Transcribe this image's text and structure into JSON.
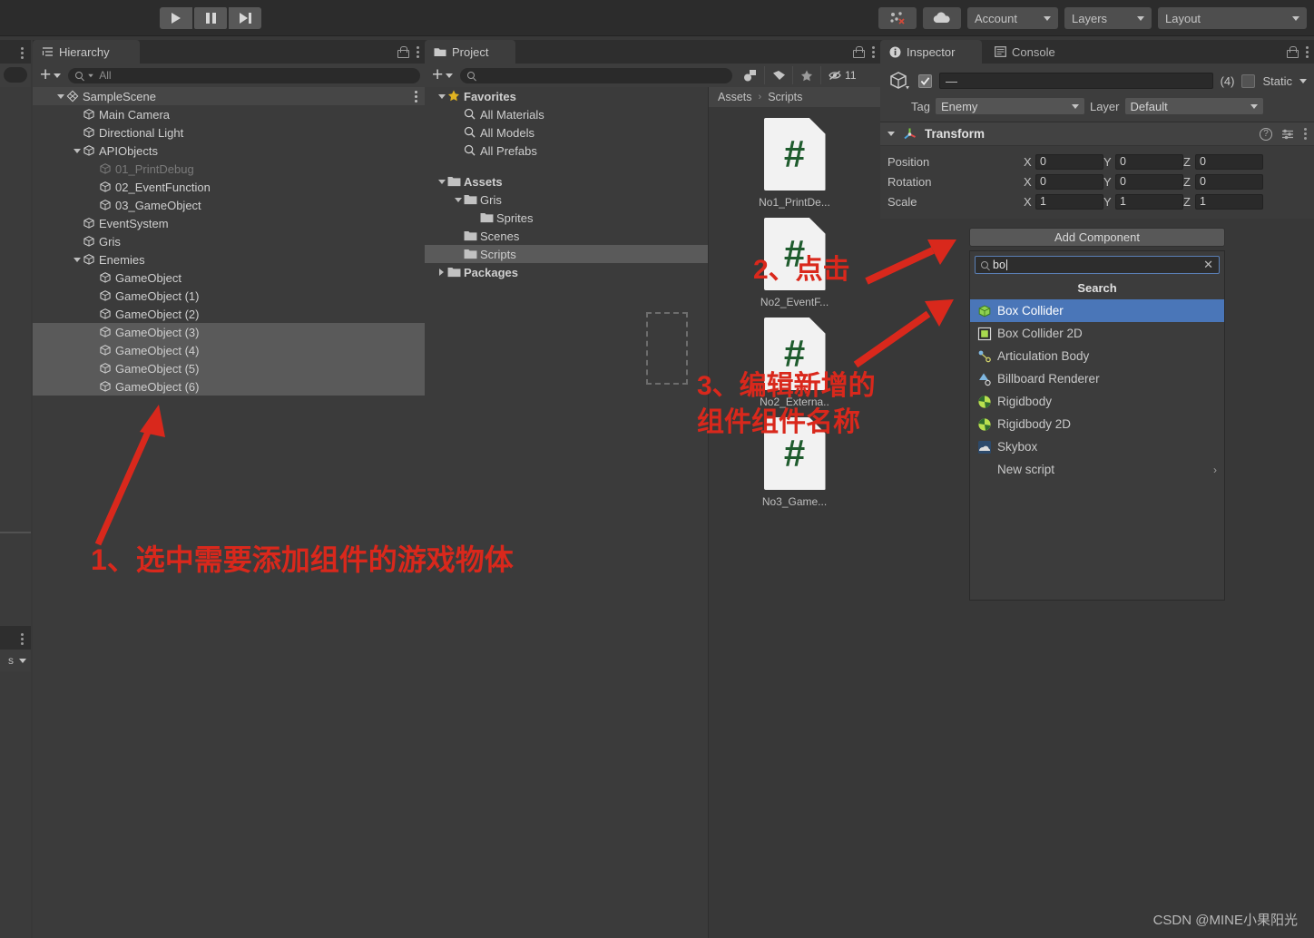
{
  "toolbar": {
    "play_label": "play-icon",
    "pause_label": "pause-icon",
    "step_label": "step-icon",
    "cloud_label": "cloud-icon",
    "collab_label": "collab-icon",
    "account": "Account",
    "layers": "Layers",
    "layout": "Layout"
  },
  "hierarchy": {
    "tab": "Hierarchy",
    "search_placeholder": "All",
    "items": [
      {
        "label": "SampleScene",
        "indent": 0,
        "arrow": "down",
        "icon": "scene-icon",
        "state": "scene"
      },
      {
        "label": "Main Camera",
        "indent": 1,
        "arrow": "none",
        "icon": "cube-icon",
        "state": "normal"
      },
      {
        "label": "Directional Light",
        "indent": 1,
        "arrow": "none",
        "icon": "cube-icon",
        "state": "normal"
      },
      {
        "label": "APIObjects",
        "indent": 1,
        "arrow": "down",
        "icon": "cube-icon",
        "state": "normal"
      },
      {
        "label": "01_PrintDebug",
        "indent": 2,
        "arrow": "none",
        "icon": "cube-icon",
        "state": "disabled"
      },
      {
        "label": "02_EventFunction",
        "indent": 2,
        "arrow": "none",
        "icon": "cube-icon",
        "state": "normal"
      },
      {
        "label": "03_GameObject",
        "indent": 2,
        "arrow": "none",
        "icon": "cube-icon",
        "state": "normal"
      },
      {
        "label": "EventSystem",
        "indent": 1,
        "arrow": "none",
        "icon": "cube-icon",
        "state": "normal"
      },
      {
        "label": "Gris",
        "indent": 1,
        "arrow": "none",
        "icon": "cube-icon",
        "state": "normal"
      },
      {
        "label": "Enemies",
        "indent": 1,
        "arrow": "down",
        "icon": "cube-icon",
        "state": "normal"
      },
      {
        "label": "GameObject",
        "indent": 2,
        "arrow": "none",
        "icon": "cube-icon",
        "state": "normal"
      },
      {
        "label": "GameObject (1)",
        "indent": 2,
        "arrow": "none",
        "icon": "cube-icon",
        "state": "normal"
      },
      {
        "label": "GameObject (2)",
        "indent": 2,
        "arrow": "none",
        "icon": "cube-icon",
        "state": "normal"
      },
      {
        "label": "GameObject (3)",
        "indent": 2,
        "arrow": "none",
        "icon": "cube-icon",
        "state": "selected"
      },
      {
        "label": "GameObject (4)",
        "indent": 2,
        "arrow": "none",
        "icon": "cube-icon",
        "state": "selected"
      },
      {
        "label": "GameObject (5)",
        "indent": 2,
        "arrow": "none",
        "icon": "cube-icon",
        "state": "selected"
      },
      {
        "label": "GameObject (6)",
        "indent": 2,
        "arrow": "none",
        "icon": "cube-icon",
        "state": "selected"
      }
    ]
  },
  "project": {
    "tab": "Project",
    "search_placeholder": "",
    "hidden_count": "11",
    "tree": [
      {
        "label": "Favorites",
        "indent": 0,
        "arrow": "down",
        "icon": "star-icon",
        "bold": true
      },
      {
        "label": "All Materials",
        "indent": 1,
        "arrow": "none",
        "icon": "search-icon",
        "bold": false
      },
      {
        "label": "All Models",
        "indent": 1,
        "arrow": "none",
        "icon": "search-icon",
        "bold": false
      },
      {
        "label": "All Prefabs",
        "indent": 1,
        "arrow": "none",
        "icon": "search-icon",
        "bold": false
      },
      {
        "label": "",
        "indent": 0,
        "arrow": "none",
        "icon": "spacer",
        "bold": false
      },
      {
        "label": "Assets",
        "indent": 0,
        "arrow": "down",
        "icon": "folder-icon",
        "bold": true
      },
      {
        "label": "Gris",
        "indent": 1,
        "arrow": "down",
        "icon": "folder-icon",
        "bold": false
      },
      {
        "label": "Sprites",
        "indent": 2,
        "arrow": "none",
        "icon": "folder-icon",
        "bold": false
      },
      {
        "label": "Scenes",
        "indent": 1,
        "arrow": "none",
        "icon": "folder-icon",
        "bold": false
      },
      {
        "label": "Scripts",
        "indent": 1,
        "arrow": "none",
        "icon": "folder-icon",
        "bold": false,
        "selected": true
      },
      {
        "label": "Packages",
        "indent": 0,
        "arrow": "right",
        "icon": "folder-icon",
        "bold": true
      }
    ],
    "breadcrumb": [
      "Assets",
      "Scripts"
    ],
    "assets": [
      {
        "label": "No1_PrintDe...",
        "icon": "csharp-script-icon"
      },
      {
        "label": "No2_EventF...",
        "icon": "csharp-script-icon"
      },
      {
        "label": "No2_Externa..",
        "icon": "csharp-script-icon"
      },
      {
        "label": "No3_Game...",
        "icon": "csharp-script-icon"
      }
    ]
  },
  "inspector": {
    "tab": "Inspector",
    "console_tab": "Console",
    "name_value": "—",
    "selection_count": "(4)",
    "static_label": "Static",
    "tag_label": "Tag",
    "tag_value": "Enemy",
    "layer_label": "Layer",
    "layer_value": "Default",
    "transform": {
      "title": "Transform",
      "rows": [
        {
          "label": "Position",
          "x": "0",
          "y": "0",
          "z": "0"
        },
        {
          "label": "Rotation",
          "x": "0",
          "y": "0",
          "z": "0"
        },
        {
          "label": "Scale",
          "x": "1",
          "y": "1",
          "z": "1"
        }
      ]
    },
    "add_component": {
      "button_label": "Add Component",
      "search_value": "bo",
      "clear_label": "✕",
      "title": "Search",
      "items": [
        {
          "label": "Box Collider",
          "icon": "box-collider-icon",
          "selected": true,
          "submenu": false
        },
        {
          "label": "Box Collider 2D",
          "icon": "box-collider-2d-icon",
          "selected": false,
          "submenu": false
        },
        {
          "label": "Articulation Body",
          "icon": "articulation-body-icon",
          "selected": false,
          "submenu": false
        },
        {
          "label": "Billboard Renderer",
          "icon": "billboard-renderer-icon",
          "selected": false,
          "submenu": false
        },
        {
          "label": "Rigidbody",
          "icon": "rigidbody-icon",
          "selected": false,
          "submenu": false
        },
        {
          "label": "Rigidbody 2D",
          "icon": "rigidbody-2d-icon",
          "selected": false,
          "submenu": false
        },
        {
          "label": "Skybox",
          "icon": "skybox-icon",
          "selected": false,
          "submenu": false
        },
        {
          "label": "New script",
          "icon": "none",
          "selected": false,
          "submenu": true
        }
      ]
    }
  },
  "annotations": {
    "step1": "1、选中需要添加组件的游戏物体",
    "step2": "2、点击",
    "step3_line1": "3、编辑新增的",
    "step3_line2": "组件组件名称",
    "color": "#d9281c"
  },
  "watermark": "CSDN @MINE小果阳光"
}
